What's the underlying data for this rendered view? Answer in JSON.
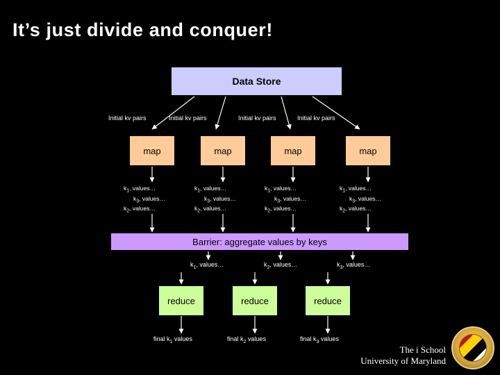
{
  "slide": {
    "title": "It’s just divide and conquer!",
    "background_color": "#000000",
    "text_color": "#ffffff"
  },
  "data_store": {
    "label": "Data Store",
    "color": "#ccccff"
  },
  "input_labels": [
    "Initial kv pairs",
    "Initial kv pairs",
    "Initial kv pairs",
    "Initial kv pairs"
  ],
  "map_stage": {
    "box_label": "map",
    "color": "#ffcc99",
    "boxes": [
      {
        "label": "map"
      },
      {
        "label": "map"
      },
      {
        "label": "map"
      },
      {
        "label": "map"
      }
    ],
    "outputs": [
      [
        "k",
        "1",
        ", values…",
        "k",
        "3",
        ", values…",
        "k",
        "2",
        ", values…"
      ],
      [
        "k",
        "1",
        ", values…",
        "k",
        "3",
        ", values…",
        "k",
        "2",
        ", values…"
      ],
      [
        "k",
        "1",
        ", values…",
        "k",
        "3",
        ", values…",
        "k",
        "2",
        ", values…"
      ],
      [
        "k",
        "1",
        ", values…",
        "k",
        "3",
        ", values…",
        "k",
        "2",
        ", values…"
      ]
    ]
  },
  "barrier": {
    "label": "Barrier: aggregate values by keys",
    "color": "#cc99ff"
  },
  "aggregated_keys": [
    {
      "key": "k",
      "sub": "1",
      "rest": ", values…"
    },
    {
      "key": "k",
      "sub": "2",
      "rest": ", values…"
    },
    {
      "key": "k",
      "sub": "3",
      "rest": ", values…"
    }
  ],
  "reduce_stage": {
    "color": "#ccff99",
    "boxes": [
      {
        "label": "reduce"
      },
      {
        "label": "reduce"
      },
      {
        "label": "reduce"
      }
    ],
    "outputs": [
      {
        "pre": "final k",
        "sub": "1",
        "post": " values"
      },
      {
        "pre": "final k",
        "sub": "2",
        "post": " values"
      },
      {
        "pre": "final k",
        "sub": "3",
        "post": " values"
      }
    ]
  },
  "footer": {
    "line1": "The i School",
    "line2": "University of Maryland",
    "seal_name": "university-seal"
  }
}
